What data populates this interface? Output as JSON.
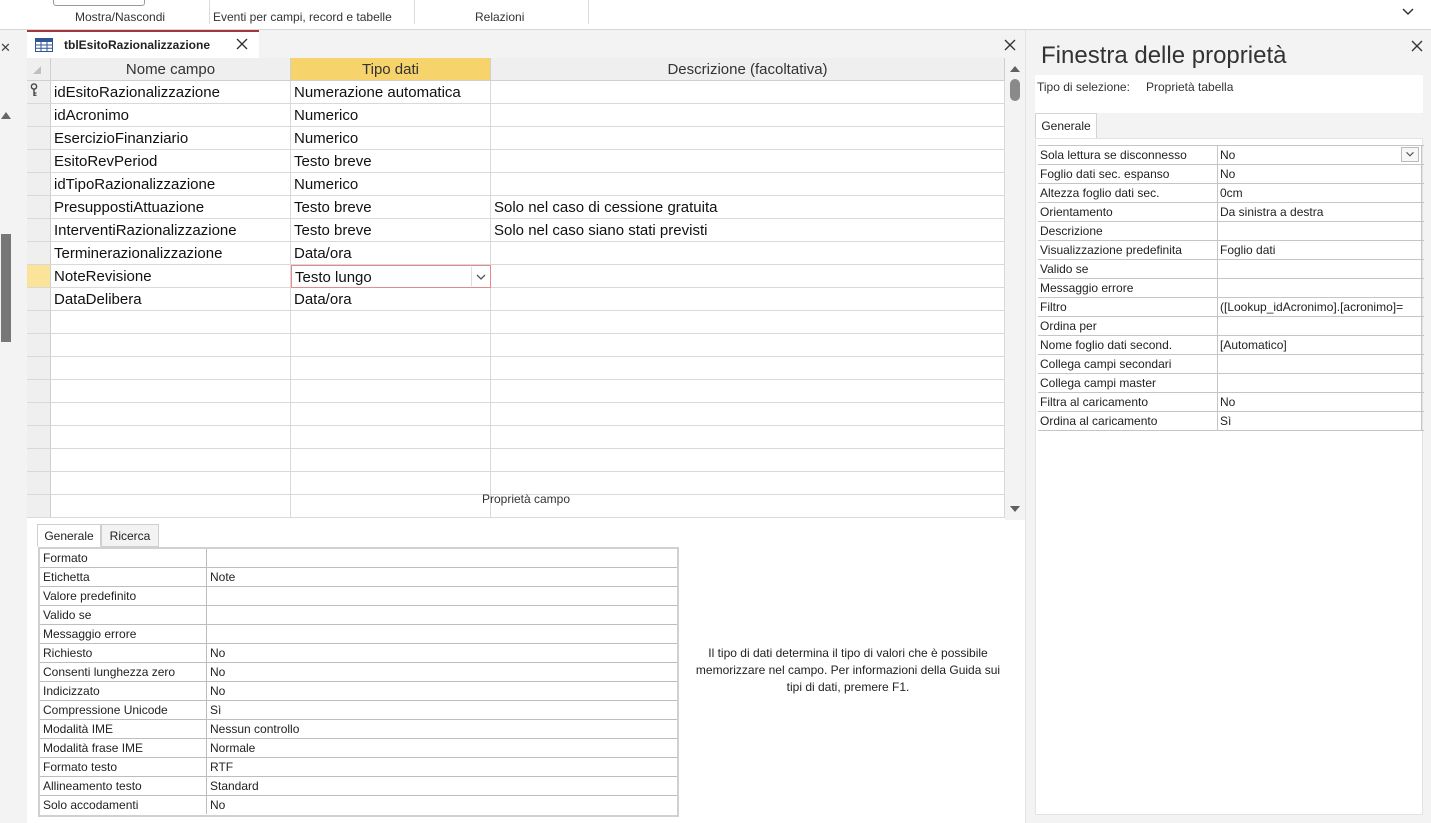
{
  "ribbon": {
    "groups": [
      "Mostra/Nascondi",
      "Eventi per campi, record e tabelle",
      "Relazioni"
    ]
  },
  "document": {
    "tab_title": "tblEsitoRazionalizzazione",
    "columns": [
      "Nome campo",
      "Tipo dati",
      "Descrizione (facoltativa)"
    ],
    "fields": [
      {
        "name": "idEsitoRazionalizzazione",
        "type": "Numerazione automatica",
        "desc": "",
        "key": true
      },
      {
        "name": "idAcronimo",
        "type": "Numerico",
        "desc": ""
      },
      {
        "name": "EsercizioFinanziario",
        "type": "Numerico",
        "desc": ""
      },
      {
        "name": "EsitoRevPeriod",
        "type": "Testo breve",
        "desc": ""
      },
      {
        "name": "idTipoRazionalizzazione",
        "type": "Numerico",
        "desc": ""
      },
      {
        "name": "PresuppostiAttuazione",
        "type": "Testo breve",
        "desc": "Solo nel caso di cessione gratuita"
      },
      {
        "name": "InterventiRazionalizzazione",
        "type": "Testo breve",
        "desc": "Solo nel caso siano stati previsti"
      },
      {
        "name": "Terminerazionalizzazione",
        "type": "Data/ora",
        "desc": ""
      },
      {
        "name": "NoteRevisione",
        "type": "Testo lungo",
        "desc": "",
        "current": true
      },
      {
        "name": "DataDelibera",
        "type": "Data/ora",
        "desc": ""
      }
    ],
    "field_props_label": "Proprietà campo",
    "field_props_tabs": [
      "Generale",
      "Ricerca"
    ],
    "field_props": [
      {
        "k": "Formato",
        "v": ""
      },
      {
        "k": "Etichetta",
        "v": "Note"
      },
      {
        "k": "Valore predefinito",
        "v": ""
      },
      {
        "k": "Valido se",
        "v": ""
      },
      {
        "k": "Messaggio errore",
        "v": ""
      },
      {
        "k": "Richiesto",
        "v": "No"
      },
      {
        "k": "Consenti lunghezza zero",
        "v": "No"
      },
      {
        "k": "Indicizzato",
        "v": "No"
      },
      {
        "k": "Compressione Unicode",
        "v": "Sì"
      },
      {
        "k": "Modalità IME",
        "v": "Nessun controllo"
      },
      {
        "k": "Modalità frase IME",
        "v": "Normale"
      },
      {
        "k": "Formato testo",
        "v": "RTF"
      },
      {
        "k": "Allineamento testo",
        "v": "Standard"
      },
      {
        "k": "Solo accodamenti",
        "v": "No"
      }
    ],
    "help_text": "Il tipo di dati determina il tipo di valori che è possibile memorizzare nel campo. Per informazioni della Guida sui tipi di dati, premere F1."
  },
  "property_sheet": {
    "title": "Finestra delle proprietà",
    "selection_label": "Tipo di selezione:",
    "selection_value": "Proprietà tabella",
    "tab": "Generale",
    "rows": [
      {
        "k": "Sola lettura se disconnesso",
        "v": "No",
        "dropdown": true
      },
      {
        "k": "Foglio dati sec. espanso",
        "v": "No"
      },
      {
        "k": "Altezza foglio dati sec.",
        "v": "0cm"
      },
      {
        "k": "Orientamento",
        "v": "Da sinistra a destra"
      },
      {
        "k": "Descrizione",
        "v": ""
      },
      {
        "k": "Visualizzazione predefinita",
        "v": "Foglio dati"
      },
      {
        "k": "Valido se",
        "v": ""
      },
      {
        "k": "Messaggio errore",
        "v": ""
      },
      {
        "k": "Filtro",
        "v": "([Lookup_idAcronimo].[acronimo]="
      },
      {
        "k": "Ordina per",
        "v": ""
      },
      {
        "k": "Nome foglio dati second.",
        "v": "[Automatico]"
      },
      {
        "k": "Collega campi secondari",
        "v": ""
      },
      {
        "k": "Collega campi master",
        "v": ""
      },
      {
        "k": "Filtra al caricamento",
        "v": "No"
      },
      {
        "k": "Ordina al caricamento",
        "v": "Sì"
      }
    ]
  },
  "colors": {
    "active_header": "#f7d36b",
    "current_row_selector": "#fbe39a",
    "tab_accent": "#a4373a"
  }
}
